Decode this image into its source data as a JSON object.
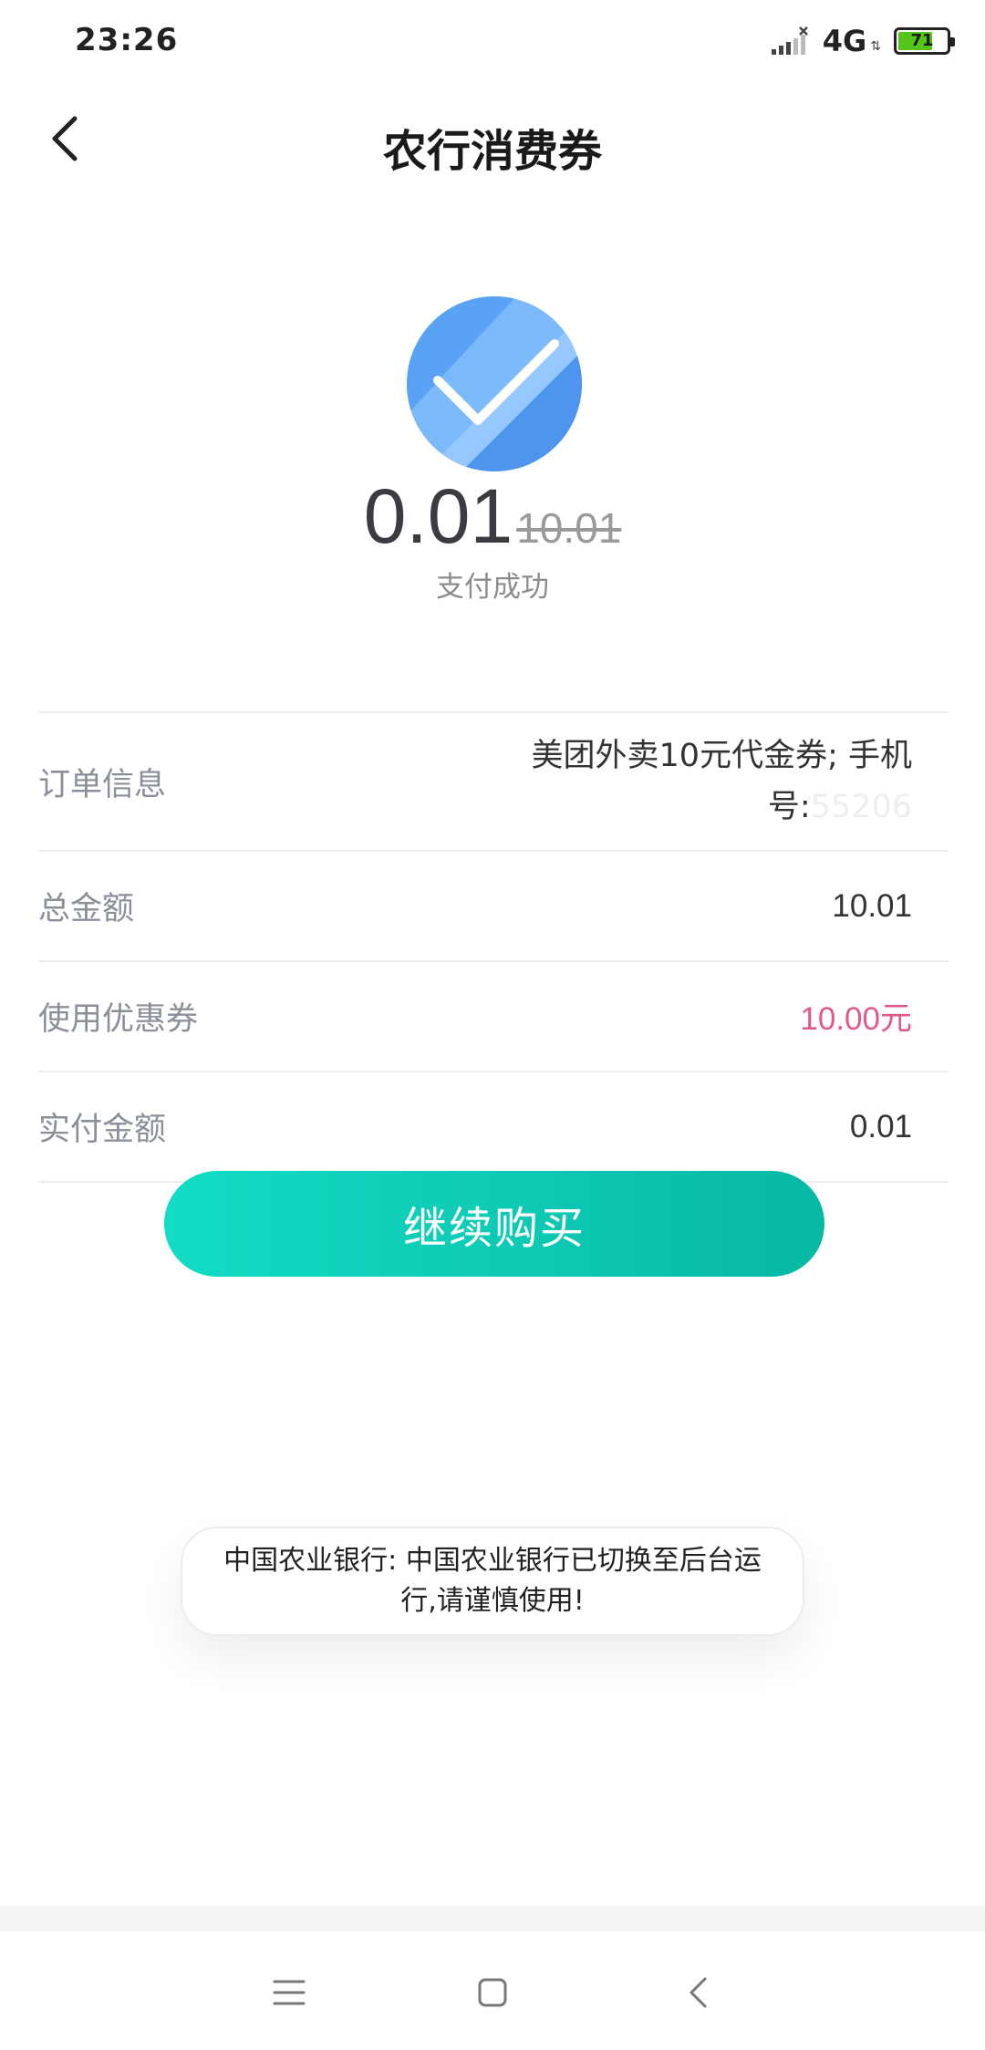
{
  "status_bar": {
    "time": "23:26",
    "network": "4G",
    "battery_percent": "71",
    "battery_level": 0.71
  },
  "header": {
    "title": "农行消费券",
    "back_icon": "chevron-left-icon"
  },
  "payment": {
    "paid_amount": "0.01",
    "original_amount": "10.01",
    "status_text": "支付成功",
    "icon": "check-circle-icon"
  },
  "details": {
    "order": {
      "label": "订单信息",
      "value": "美团外卖10元代金券; 手机号:",
      "value_hidden_tail": "55206"
    },
    "total": {
      "label": "总金额",
      "value": "10.01"
    },
    "coupon": {
      "label": "使用优惠券",
      "value": "10.00元"
    },
    "actual": {
      "label": "实付金额",
      "value": "0.01"
    }
  },
  "actions": {
    "continue_label": "继续购买"
  },
  "toast": {
    "message": "中国农业银行: 中国农业银行已切换至后台运行,请谨慎使用!"
  },
  "colors": {
    "accent": "#0dc7b2",
    "success_blue": "#5aa2f5",
    "coupon_pink": "#e05a86",
    "battery_green": "#52c41a"
  },
  "nav": {
    "menu_icon": "menu-icon",
    "home_icon": "square-home-icon",
    "back_icon": "triangle-back-icon"
  }
}
